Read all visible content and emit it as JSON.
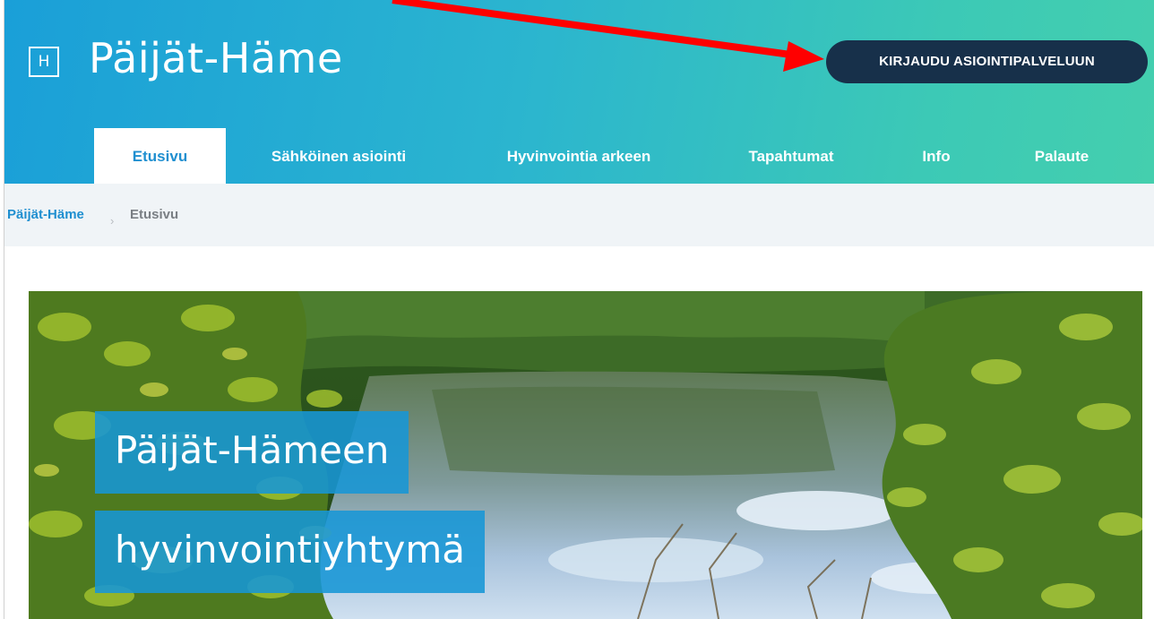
{
  "header": {
    "logo_letter": "H",
    "site_title": "Päijät-Häme",
    "login_label": "KIRJAUDU ASIOINTIPALVELUUN",
    "gradient": [
      "#1a9fd8",
      "#44cfae"
    ],
    "login_color": "#17304a"
  },
  "nav": {
    "items": [
      {
        "label": "Etusivu",
        "active": true
      },
      {
        "label": "Sähköinen asiointi",
        "active": false
      },
      {
        "label": "Hyvinvointia arkeen",
        "active": false
      },
      {
        "label": "Tapahtumat",
        "active": false
      },
      {
        "label": "Info",
        "active": false
      },
      {
        "label": "Palaute",
        "active": false
      }
    ]
  },
  "breadcrumb": {
    "root": "Päijät-Häme",
    "separator": "›",
    "current": "Etusivu"
  },
  "hero": {
    "line1": "Päijät-Hämeen",
    "line2": "hyvinvointiyhtymä",
    "overlay_color": "#1796d6"
  },
  "annotation": {
    "arrow_color": "#ff0000",
    "arrow_icon": "red-arrow-icon"
  }
}
